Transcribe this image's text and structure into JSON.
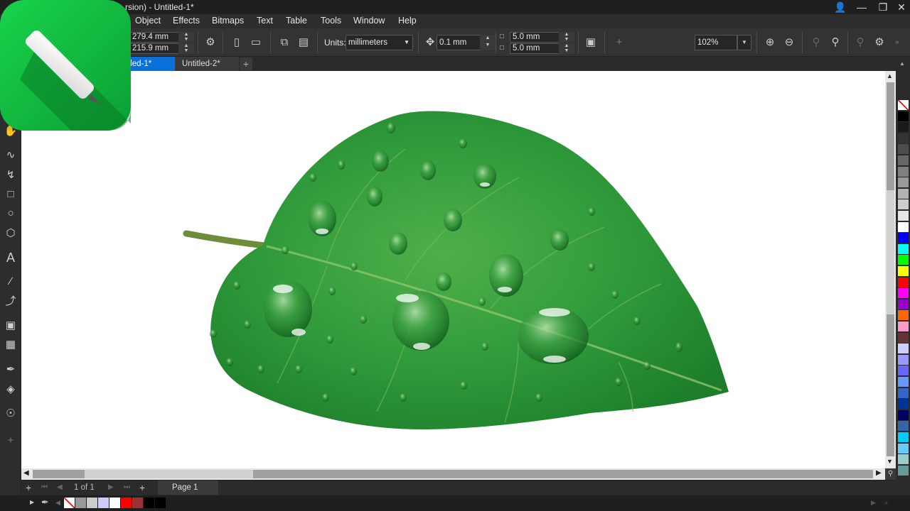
{
  "app": {
    "title": "rsion) - Untitled-1*"
  },
  "menus": [
    {
      "label": "Object"
    },
    {
      "label": "Effects"
    },
    {
      "label": "Bitmaps"
    },
    {
      "label": "Text"
    },
    {
      "label": "Table"
    },
    {
      "label": "Tools"
    },
    {
      "label": "Window"
    },
    {
      "label": "Help"
    }
  ],
  "propbar": {
    "width": "279.4 mm",
    "height": "215.9 mm",
    "units_label": "Units:",
    "units_value": "millimeters",
    "nudge": "0.1 mm",
    "dup_x": "5.0 mm",
    "dup_y": "5.0 mm",
    "zoom": "102%"
  },
  "tabs": [
    {
      "label": "tled-1*",
      "active": true
    },
    {
      "label": "Untitled-2*",
      "active": false
    }
  ],
  "pagebar": {
    "page_count": "1 of 1",
    "page_tab": "Page 1"
  },
  "colors": {
    "accent": "#0a6fd8",
    "logo_green": "#12c443",
    "palette": [
      "#ffffff",
      "#000000",
      "#1a1a1a",
      "#333333",
      "#4d4d4d",
      "#666666",
      "#808080",
      "#999999",
      "#b3b3b3",
      "#cccccc",
      "#e6e6e6",
      "#ffffff",
      "#0000ff",
      "#00ffff",
      "#00ff00",
      "#ffff00",
      "#ff0000",
      "#ff00ff",
      "#9900cc",
      "#ff6600",
      "#ff99cc",
      "#663333",
      "#ccccff",
      "#9999ff",
      "#6666ff",
      "#6699ff",
      "#3366cc",
      "#003399",
      "#000066",
      "#3366aa",
      "#00ccff",
      "#66ccff",
      "#99cccc",
      "#669999"
    ],
    "doc_palette": [
      "#ffffff",
      "#999999",
      "#cccccc",
      "#ccccff",
      "#ffffff",
      "#ff0000",
      "#993333",
      "#000000",
      "#000000"
    ]
  }
}
